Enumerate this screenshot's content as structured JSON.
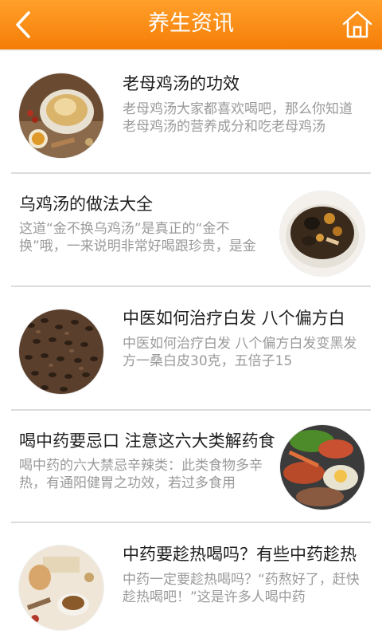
{
  "header": {
    "title": "养生资讯",
    "back_icon": "chevron-left-icon",
    "home_icon": "home-icon",
    "color": "#f78a12"
  },
  "articles": [
    {
      "title": "老母鸡汤的功效",
      "desc": "老母鸡汤大家都喜欢喝吧，那么你知道老母鸡汤的营养成分和吃老母鸡汤",
      "image": "chicken-soup-photo"
    },
    {
      "title": "乌鸡汤的做法大全",
      "desc": "这道“金不换乌鸡汤”是真正的“金不换”哦，一来说明非常好喝跟珍贵，是金",
      "image": "black-chicken-soup-photo"
    },
    {
      "title": "中医如何治疗白发 八个偏方白",
      "desc": "中医如何治疗白发 八个偏方白发变黑发方一桑白皮30克，五倍子15",
      "image": "black-seeds-photo"
    },
    {
      "title": "喝中药要忌口 注意这六大类解药食",
      "desc": "喝中药的六大禁忌辛辣类：此类食物多辛热，有通阳健胃之功效，若过多食用",
      "image": "seafood-platter-photo"
    },
    {
      "title": "中药要趁热喝吗？有些中药趁热",
      "desc": "中药一定要趁热喝吗？“药熬好了，赶快趁热喝吧！”这是许多人喝中药",
      "image": "herbal-tea-photo"
    }
  ]
}
